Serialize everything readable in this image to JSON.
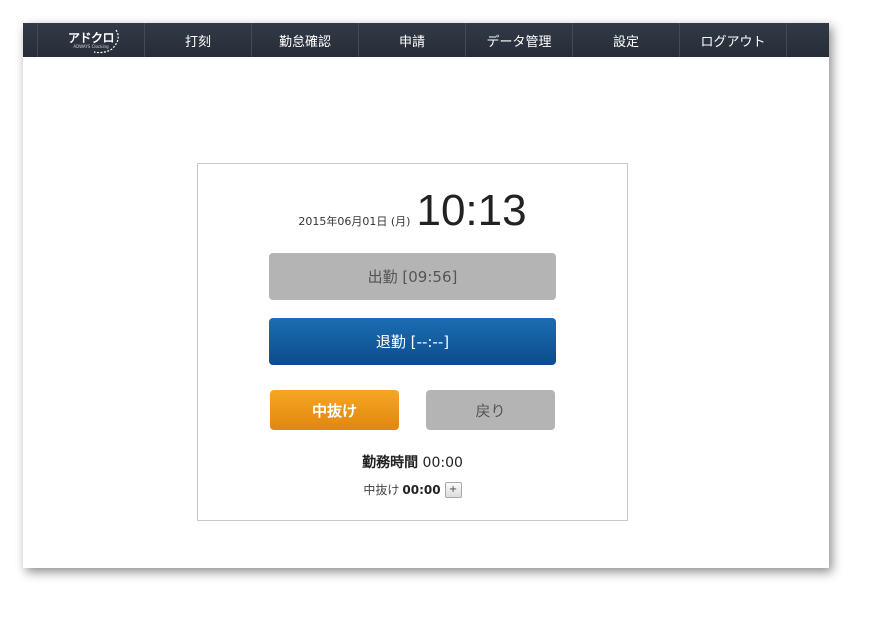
{
  "logo": {
    "text": "アドクロ",
    "subtext": "ADWAYS Clocking"
  },
  "nav": {
    "items": [
      {
        "label": "打刻"
      },
      {
        "label": "勤怠確認"
      },
      {
        "label": "申請"
      },
      {
        "label": "データ管理"
      },
      {
        "label": "設定"
      },
      {
        "label": "ログアウト"
      }
    ]
  },
  "clock": {
    "date": "2015年06月01日 (月)",
    "time": "10:13"
  },
  "buttons": {
    "clock_in": "出勤 [09:56]",
    "clock_out": "退勤 [--:--]",
    "break_start": "中抜け",
    "break_return": "戻り"
  },
  "summary": {
    "work_time_label": "勤務時間",
    "work_time_value": "00:00",
    "break_label": "中抜け",
    "break_value": "00:00",
    "expand_label": "+"
  },
  "colors": {
    "navbar": "#2b323d",
    "clock_out_button": "#0f5aa0",
    "break_button": "#f0961c",
    "disabled_button": "#b4b4b4"
  }
}
